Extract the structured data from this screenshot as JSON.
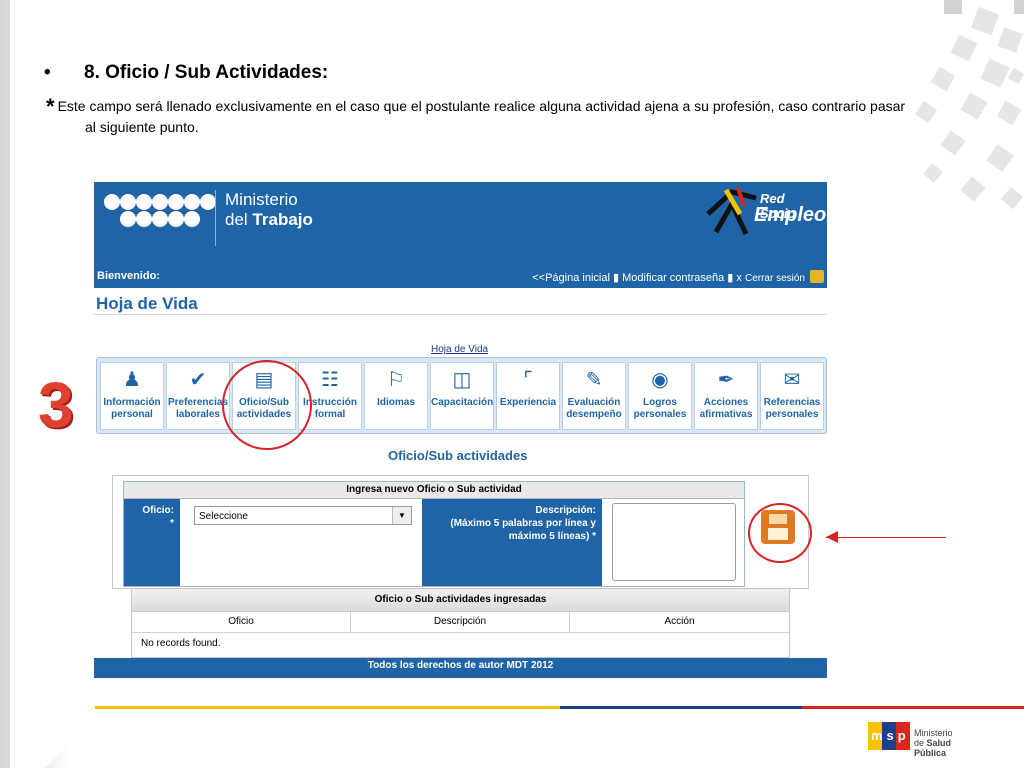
{
  "slide": {
    "heading_bullet": "•",
    "heading": "8. Oficio / Sub Actividades:",
    "note_star": "*",
    "note_line1": "Este campo será llenado exclusivamente en el caso que el postulante realice alguna actividad ajena a su profesión, caso contrario pasar",
    "note_line2": "al siguiente punto.",
    "step_number": "3"
  },
  "app": {
    "ministry_line1": "Ministerio",
    "ministry_line2_pre": "del ",
    "ministry_line2_bold": "Trabajo",
    "brand_line1": "Red Socio",
    "brand_line2": "Empleo",
    "welcome": "Bienvenido:",
    "link_home": "<<Página inicial",
    "link_change_password": "Modificar contraseña",
    "link_logout_x": "x",
    "link_logout": "Cerrar sesión",
    "page_title": "Hoja de Vida",
    "breadcrumb_link": "Hoja de Vida",
    "tabs": [
      {
        "line1": "Información",
        "line2": "personal",
        "icon": "person-icon"
      },
      {
        "line1": "Preferencias",
        "line2": "laborales",
        "icon": "checkmark-icon"
      },
      {
        "line1": "Oficio/Sub",
        "line2": "actividades",
        "icon": "id-card-icon"
      },
      {
        "line1": "Instrucción",
        "line2": "formal",
        "icon": "book-icon"
      },
      {
        "line1": "Idiomas",
        "line2": "",
        "icon": "speech-icon"
      },
      {
        "line1": "Capacitación",
        "line2": "",
        "icon": "presentation-icon"
      },
      {
        "line1": "Experiencia",
        "line2": "",
        "icon": "stairs-icon"
      },
      {
        "line1": "Evaluación",
        "line2": "desempeño",
        "icon": "edit-icon"
      },
      {
        "line1": "Logros",
        "line2": "personales",
        "icon": "medal-icon"
      },
      {
        "line1": "Acciones",
        "line2": "afirmativas",
        "icon": "pen-icon"
      },
      {
        "line1": "Referencias",
        "line2": "personales",
        "icon": "chat-icon"
      }
    ],
    "section_title": "Oficio/Sub actividades",
    "form_title": "Ingresa nuevo Oficio o Sub actividad",
    "oficio_label": "Oficio:",
    "oficio_required": "*",
    "oficio_select_value": "Seleccione",
    "descripcion_label": "Descripción:",
    "descripcion_hint1": "(Máximo 5 palabras por línea y",
    "descripcion_hint2": "máximo 5 líneas) *",
    "grid_title": "Oficio o Sub actividades ingresadas",
    "grid_columns": [
      "Oficio",
      "Descripción",
      "Acción"
    ],
    "grid_empty": "No records found.",
    "footer": "Todos los derechos de autor MDT 2012"
  },
  "logo": {
    "line1": "Ministerio",
    "line2_pre": "de ",
    "line2_bold": "Salud Pública",
    "letters": "msp"
  },
  "colors": {
    "brand_blue": "#1f64a7",
    "annotation_red": "#d4242a",
    "save_orange": "#e07a22"
  }
}
